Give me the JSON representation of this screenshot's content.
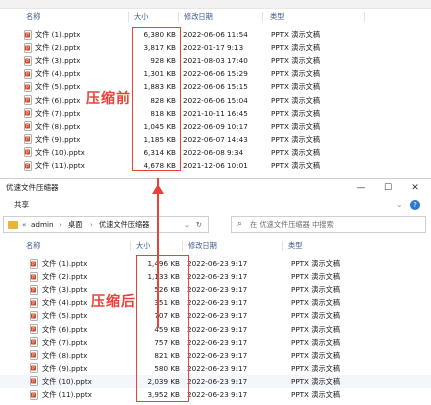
{
  "colors": {
    "accent_red": "#e8423a",
    "header_text": "#3a5a8c",
    "folder": "#e8b43c",
    "pptx": "#d24726"
  },
  "before": {
    "columns": {
      "name": "名称",
      "size": "大小",
      "date": "修改日期",
      "type": "类型"
    },
    "annotation": "压缩前",
    "files": [
      {
        "name": "文件 (1).pptx",
        "size": "6,380 KB",
        "date": "2022-06-06 11:54",
        "type": "PPTX 演示文稿"
      },
      {
        "name": "文件 (2).pptx",
        "size": "3,817 KB",
        "date": "2022-01-17 9:13",
        "type": "PPTX 演示文稿"
      },
      {
        "name": "文件 (3).pptx",
        "size": "928 KB",
        "date": "2021-08-03 17:40",
        "type": "PPTX 演示文稿"
      },
      {
        "name": "文件 (4).pptx",
        "size": "1,301 KB",
        "date": "2022-06-06 15:29",
        "type": "PPTX 演示文稿"
      },
      {
        "name": "文件 (5).pptx",
        "size": "1,883 KB",
        "date": "2022-06-06 15:15",
        "type": "PPTX 演示文稿"
      },
      {
        "name": "文件 (6).pptx",
        "size": "828 KB",
        "date": "2022-06-06 15:04",
        "type": "PPTX 演示文稿"
      },
      {
        "name": "文件 (7).pptx",
        "size": "818 KB",
        "date": "2021-10-11 16:45",
        "type": "PPTX 演示文稿"
      },
      {
        "name": "文件 (8).pptx",
        "size": "1,045 KB",
        "date": "2022-06-09 10:17",
        "type": "PPTX 演示文稿"
      },
      {
        "name": "文件 (9).pptx",
        "size": "1,185 KB",
        "date": "2022-06-07 14:43",
        "type": "PPTX 演示文稿"
      },
      {
        "name": "文件 (10).pptx",
        "size": "6,314 KB",
        "date": "2022-06-08 9:34",
        "type": "PPTX 演示文稿"
      },
      {
        "name": "文件 (11).pptx",
        "size": "4,678 KB",
        "date": "2021-12-06 10:01",
        "type": "PPTX 演示文稿"
      }
    ]
  },
  "window": {
    "title": "优速文件压缩器",
    "minimize": "—",
    "maximize": "☐",
    "close": "✕",
    "menu_share": "共享",
    "help_glyph": "?",
    "path": [
      "admin",
      "桌面",
      "优速文件压缩器"
    ],
    "search_placeholder": "在 优速文件压缩器 中搜索"
  },
  "after": {
    "columns": {
      "name": "名称",
      "size": "大小",
      "date": "修改日期",
      "type": "类型"
    },
    "annotation": "压缩后",
    "files": [
      {
        "name": "文件 (1).pptx",
        "size": "1,496 KB",
        "date": "2022-06-23 9:17",
        "type": "PPTX 演示文稿"
      },
      {
        "name": "文件 (2).pptx",
        "size": "1,133 KB",
        "date": "2022-06-23 9:17",
        "type": "PPTX 演示文稿"
      },
      {
        "name": "文件 (3).pptx",
        "size": "526 KB",
        "date": "2022-06-23 9:17",
        "type": "PPTX 演示文稿"
      },
      {
        "name": "文件 (4).pptx",
        "size": "351 KB",
        "date": "2022-06-23 9:17",
        "type": "PPTX 演示文稿"
      },
      {
        "name": "文件 (5).pptx",
        "size": "707 KB",
        "date": "2022-06-23 9:17",
        "type": "PPTX 演示文稿"
      },
      {
        "name": "文件 (6).pptx",
        "size": "459 KB",
        "date": "2022-06-23 9:17",
        "type": "PPTX 演示文稿"
      },
      {
        "name": "文件 (7).pptx",
        "size": "757 KB",
        "date": "2022-06-23 9:17",
        "type": "PPTX 演示文稿"
      },
      {
        "name": "文件 (8).pptx",
        "size": "821 KB",
        "date": "2022-06-23 9:17",
        "type": "PPTX 演示文稿"
      },
      {
        "name": "文件 (9).pptx",
        "size": "580 KB",
        "date": "2022-06-23 9:17",
        "type": "PPTX 演示文稿"
      },
      {
        "name": "文件 (10).pptx",
        "size": "2,039 KB",
        "date": "2022-06-23 9:17",
        "type": "PPTX 演示文稿"
      },
      {
        "name": "文件 (11).pptx",
        "size": "3,952 KB",
        "date": "2022-06-23 9:17",
        "type": "PPTX 演示文稿"
      }
    ]
  }
}
